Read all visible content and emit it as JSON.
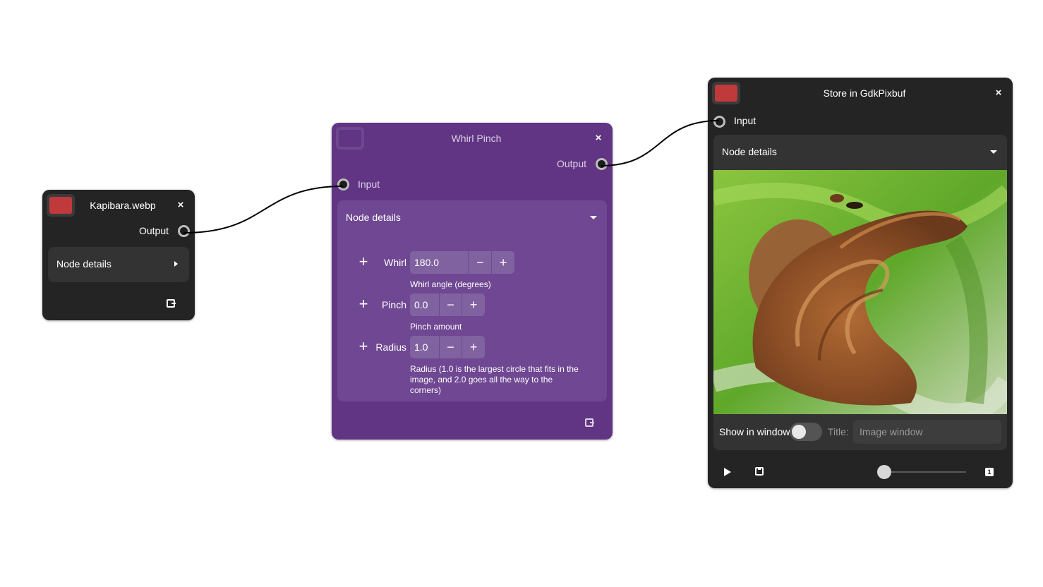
{
  "connections_color": "#000000",
  "nodes": {
    "kapibara": {
      "title": "Kapibara.webp",
      "close": "×",
      "output_label": "Output",
      "details_label": "Node details",
      "color_swatch": "#c0393b"
    },
    "whirl": {
      "title": "Whirl Pinch",
      "close": "×",
      "output_label": "Output",
      "input_label": "Input",
      "details_label": "Node details",
      "color_swatch": "#613583",
      "params": [
        {
          "label": "Whirl",
          "value": "180.0",
          "description": "Whirl angle (degrees)",
          "minus": "−",
          "plus": "+"
        },
        {
          "label": "Pinch",
          "value": "0.0",
          "description": "Pinch amount",
          "minus": "−",
          "plus": "+"
        },
        {
          "label": "Radius",
          "value": "1.0",
          "description": "Radius (1.0 is the largest circle that fits in the image, and 2.0 goes all the way to the corners)",
          "minus": "−",
          "plus": "+"
        }
      ]
    },
    "store": {
      "title": "Store in GdkPixbuf",
      "close": "×",
      "input_label": "Input",
      "details_label": "Node details",
      "color_swatch": "#c0393b",
      "show_in_window_label": "Show in window",
      "show_in_window": false,
      "title_label": "Title:",
      "title_placeholder": "Image window",
      "slider_value": 0,
      "one_label": "1"
    }
  }
}
